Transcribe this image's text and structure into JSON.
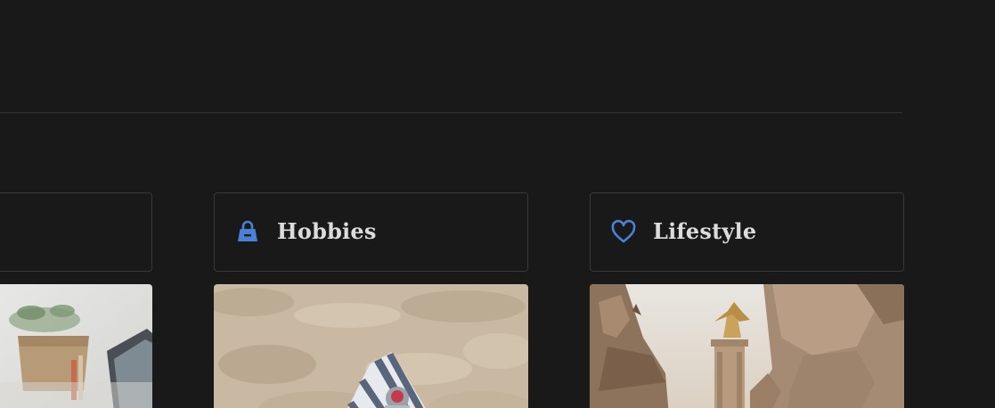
{
  "categories": [
    {
      "label": "",
      "icon": "none"
    },
    {
      "label": "Hobbies",
      "icon": "bag-icon"
    },
    {
      "label": "Lifestyle",
      "icon": "heart-icon"
    }
  ],
  "colors": {
    "background": "#1a191a",
    "accent": "#4a80d6",
    "card_border": "#3a393a",
    "label_text": "#dcdcdc"
  }
}
